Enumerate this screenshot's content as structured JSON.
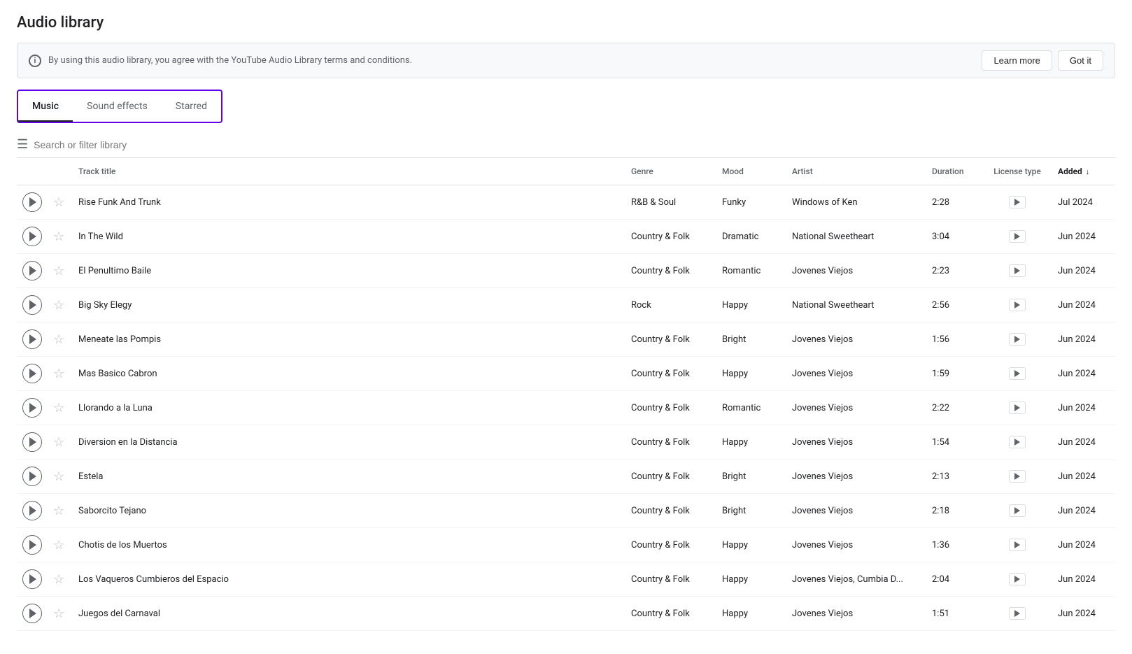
{
  "page": {
    "title": "Audio library"
  },
  "notice": {
    "text": "By using this audio library, you agree with the YouTube Audio Library terms and conditions.",
    "learn_more": "Learn more",
    "got_it": "Got it"
  },
  "tabs": [
    {
      "id": "music",
      "label": "Music",
      "active": true
    },
    {
      "id": "sound-effects",
      "label": "Sound effects",
      "active": false
    },
    {
      "id": "starred",
      "label": "Starred",
      "active": false
    }
  ],
  "filter": {
    "placeholder": "Search or filter library"
  },
  "table": {
    "columns": [
      {
        "id": "play",
        "label": ""
      },
      {
        "id": "star",
        "label": ""
      },
      {
        "id": "title",
        "label": "Track title"
      },
      {
        "id": "genre",
        "label": "Genre"
      },
      {
        "id": "mood",
        "label": "Mood"
      },
      {
        "id": "artist",
        "label": "Artist"
      },
      {
        "id": "duration",
        "label": "Duration"
      },
      {
        "id": "license",
        "label": "License type"
      },
      {
        "id": "added",
        "label": "Added",
        "sorted": true,
        "direction": "desc"
      }
    ],
    "rows": [
      {
        "title": "Rise Funk And Trunk",
        "genre": "R&B & Soul",
        "mood": "Funky",
        "artist": "Windows of Ken",
        "duration": "2:28",
        "added": "Jul 2024"
      },
      {
        "title": "In The Wild",
        "genre": "Country & Folk",
        "mood": "Dramatic",
        "artist": "National Sweetheart",
        "duration": "3:04",
        "added": "Jun 2024"
      },
      {
        "title": "El Penultimo Baile",
        "genre": "Country & Folk",
        "mood": "Romantic",
        "artist": "Jovenes Viejos",
        "duration": "2:23",
        "added": "Jun 2024"
      },
      {
        "title": "Big Sky Elegy",
        "genre": "Rock",
        "mood": "Happy",
        "artist": "National Sweetheart",
        "duration": "2:56",
        "added": "Jun 2024"
      },
      {
        "title": "Meneate las Pompis",
        "genre": "Country & Folk",
        "mood": "Bright",
        "artist": "Jovenes Viejos",
        "duration": "1:56",
        "added": "Jun 2024"
      },
      {
        "title": "Mas Basico Cabron",
        "genre": "Country & Folk",
        "mood": "Happy",
        "artist": "Jovenes Viejos",
        "duration": "1:59",
        "added": "Jun 2024"
      },
      {
        "title": "Llorando a la Luna",
        "genre": "Country & Folk",
        "mood": "Romantic",
        "artist": "Jovenes Viejos",
        "duration": "2:22",
        "added": "Jun 2024"
      },
      {
        "title": "Diversion en la Distancia",
        "genre": "Country & Folk",
        "mood": "Happy",
        "artist": "Jovenes Viejos",
        "duration": "1:54",
        "added": "Jun 2024"
      },
      {
        "title": "Estela",
        "genre": "Country & Folk",
        "mood": "Bright",
        "artist": "Jovenes Viejos",
        "duration": "2:13",
        "added": "Jun 2024"
      },
      {
        "title": "Saborcito Tejano",
        "genre": "Country & Folk",
        "mood": "Bright",
        "artist": "Jovenes Viejos",
        "duration": "2:18",
        "added": "Jun 2024"
      },
      {
        "title": "Chotis de los Muertos",
        "genre": "Country & Folk",
        "mood": "Happy",
        "artist": "Jovenes Viejos",
        "duration": "1:36",
        "added": "Jun 2024"
      },
      {
        "title": "Los Vaqueros Cumbieros del Espacio",
        "genre": "Country & Folk",
        "mood": "Happy",
        "artist": "Jovenes Viejos, Cumbia D...",
        "duration": "2:04",
        "added": "Jun 2024"
      },
      {
        "title": "Juegos del Carnaval",
        "genre": "Country & Folk",
        "mood": "Happy",
        "artist": "Jovenes Viejos",
        "duration": "1:51",
        "added": "Jun 2024"
      }
    ]
  }
}
